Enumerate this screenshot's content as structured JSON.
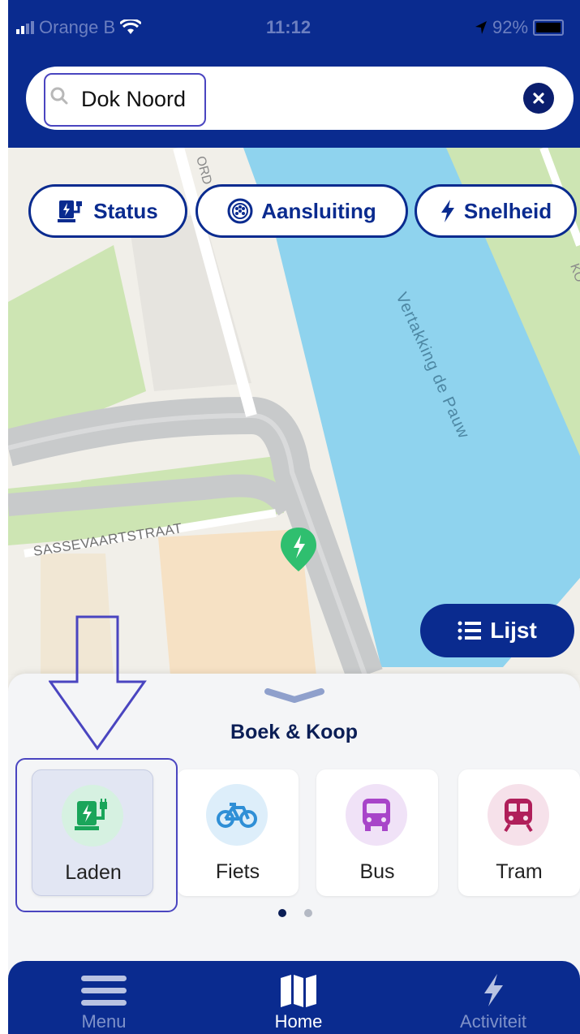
{
  "status_bar": {
    "carrier": "Orange B",
    "time": "11:12",
    "battery": "92%"
  },
  "search": {
    "value": "Dok Noord"
  },
  "filters": [
    {
      "label": "Status"
    },
    {
      "label": "Aansluiting"
    },
    {
      "label": "Snelheid"
    }
  ],
  "map": {
    "labels": {
      "street_top": "ORD",
      "waterway": "Vertakking de Pauw",
      "street": "SASSEVAARTSTRAAT",
      "edge": "KO"
    },
    "list_button": "Lijst"
  },
  "sheet": {
    "title": "Boek & Koop",
    "cards": [
      {
        "label": "Laden",
        "color": "#1aa55a",
        "bg": "#d6f1e1"
      },
      {
        "label": "Fiets",
        "color": "#2f8fd6",
        "bg": "#ddeefa"
      },
      {
        "label": "Bus",
        "color": "#a845c9",
        "bg": "#f0e2f7"
      },
      {
        "label": "Tram",
        "color": "#b01f5a",
        "bg": "#f6e1ea"
      }
    ],
    "page_index": 1,
    "page_count": 2
  },
  "tabs": [
    {
      "label": "Menu",
      "active": false
    },
    {
      "label": "Home",
      "active": true
    },
    {
      "label": "Activiteit",
      "active": false
    }
  ],
  "colors": {
    "brand": "#0a2b8f",
    "water": "#8fd3ee",
    "park": "#cfe6b8",
    "road": "#c9cbcc",
    "annotation": "#4a45c0"
  }
}
